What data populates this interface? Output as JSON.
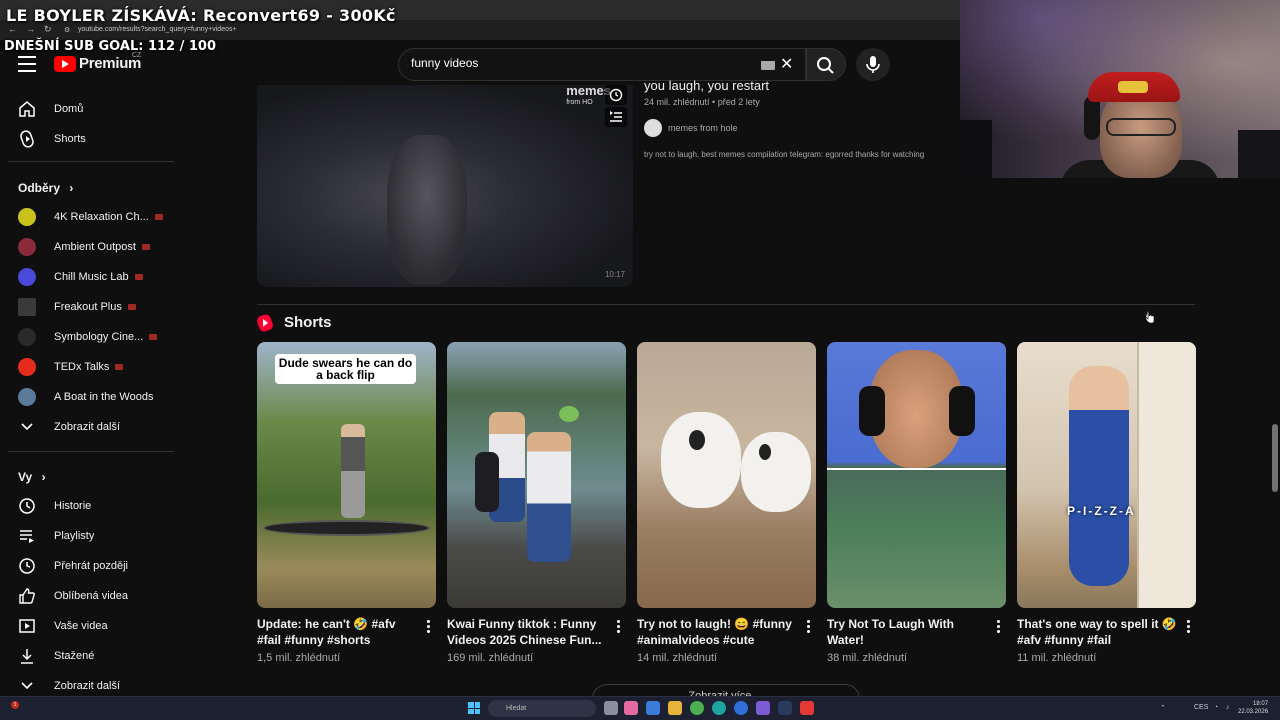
{
  "overlay": {
    "title": "LE BOYLER ZÍSKÁVÁ: Reconvert69 - 300Kč",
    "goal": "DNEŠNÍ SUB GOAL: 112 / 100"
  },
  "browser": {
    "url": "youtube.com/results?search_query=funny+videos+"
  },
  "header": {
    "logo_text": "Premium",
    "logo_region": "CZ",
    "search_value": "funny videos"
  },
  "sidebar": {
    "main": [
      {
        "label": "Domů",
        "icon": "home-icon"
      },
      {
        "label": "Shorts",
        "icon": "shorts-icon"
      }
    ],
    "subscriptions_heading": "Odběry",
    "subscriptions": [
      {
        "label": "4K Relaxation Ch...",
        "color": "#c9c21a"
      },
      {
        "label": "Ambient Outpost",
        "color": "#8a2a3a"
      },
      {
        "label": "Chill Music Lab",
        "color": "#4a4ad8"
      },
      {
        "label": "Freakout Plus",
        "color": "#3a3a3a"
      },
      {
        "label": "Symbology Cine...",
        "color": "#2a2a2a"
      },
      {
        "label": "TEDx Talks",
        "color": "#e62b1e"
      },
      {
        "label": "A Boat in the Woods",
        "color": "#5a7a9a"
      }
    ],
    "show_more_subs": "Zobrazit další",
    "you_heading": "Vy",
    "you_items": [
      {
        "label": "Historie",
        "icon": "history-icon"
      },
      {
        "label": "Playlisty",
        "icon": "playlist-icon"
      },
      {
        "label": "Přehrát později",
        "icon": "clock-icon"
      },
      {
        "label": "Oblíbená videa",
        "icon": "thumbs-up-icon"
      },
      {
        "label": "Vaše videa",
        "icon": "video-icon"
      },
      {
        "label": "Stažené",
        "icon": "download-icon"
      },
      {
        "label": "Zobrazit další",
        "icon": "chevron-down-icon"
      }
    ]
  },
  "top_video": {
    "title": "you laugh, you restart",
    "views": "24 mil. zhlédnutí",
    "age": "před 2 lety",
    "channel": "memes from hole",
    "description": "try not to laugh, best memes compilation telegram: egorred thanks for watching",
    "thumb_brand": "memes",
    "thumb_brand_sub": "from HO",
    "duration": "10:17"
  },
  "shorts": {
    "heading": "Shorts",
    "items": [
      {
        "title": "Update: he can't 🤣 #afv #fail #funny #shorts",
        "views": "1,5 mil. zhlédnutí",
        "caption": "Dude swears he can do a back flip"
      },
      {
        "title": "Kwai Funny tiktok : Funny Videos 2025 Chinese Fun...",
        "views": "169 mil. zhlédnutí"
      },
      {
        "title": "Try not to laugh! 😄 #funny #animalvideos #cute",
        "views": "14 mil. zhlédnutí"
      },
      {
        "title": "Try Not To Laugh With Water!",
        "views": "38 mil. zhlédnutí"
      },
      {
        "title": "That's one way to spell it 🤣 #afv #funny #fail",
        "views": "11 mil. zhlédnutí",
        "caption": "P-I-Z-Z-A"
      }
    ],
    "show_more": "Zobrazit více"
  },
  "taskbar": {
    "search_placeholder": "Hledat",
    "lang": "CES",
    "time": "18:07",
    "date": "22.03.2026",
    "notification_count": "1"
  }
}
